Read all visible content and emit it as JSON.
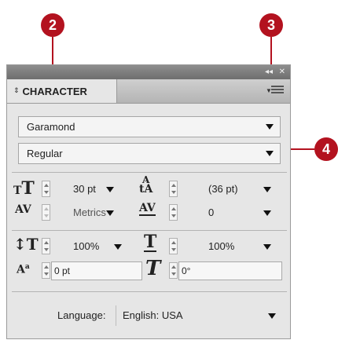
{
  "callouts": {
    "c2": "2",
    "c3": "3",
    "c4": "4"
  },
  "panel": {
    "title_controls": {
      "collapse": "◂◂",
      "close": "✕"
    },
    "tab_label": "CHARACTER",
    "tab_arrows": "⇕",
    "font_family": "Garamond",
    "font_style": "Regular",
    "font_size": "30 pt",
    "leading": "(36 pt)",
    "kerning": "Metrics",
    "tracking": "0",
    "vertical_scale": "100%",
    "horizontal_scale": "100%",
    "baseline_shift": "0 pt",
    "character_rotation": "0°",
    "language_label": "Language:",
    "language_value": "English: USA"
  },
  "icons": {
    "font_size": "tT",
    "leading": "A/A",
    "kerning": "AV",
    "tracking": "AV",
    "vertical_scale": "IT",
    "horizontal_scale": "T",
    "baseline_shift": "Aa",
    "rotation": "T"
  },
  "colors": {
    "callout": "#b3121f",
    "panel_bg": "#e6e6e6"
  }
}
